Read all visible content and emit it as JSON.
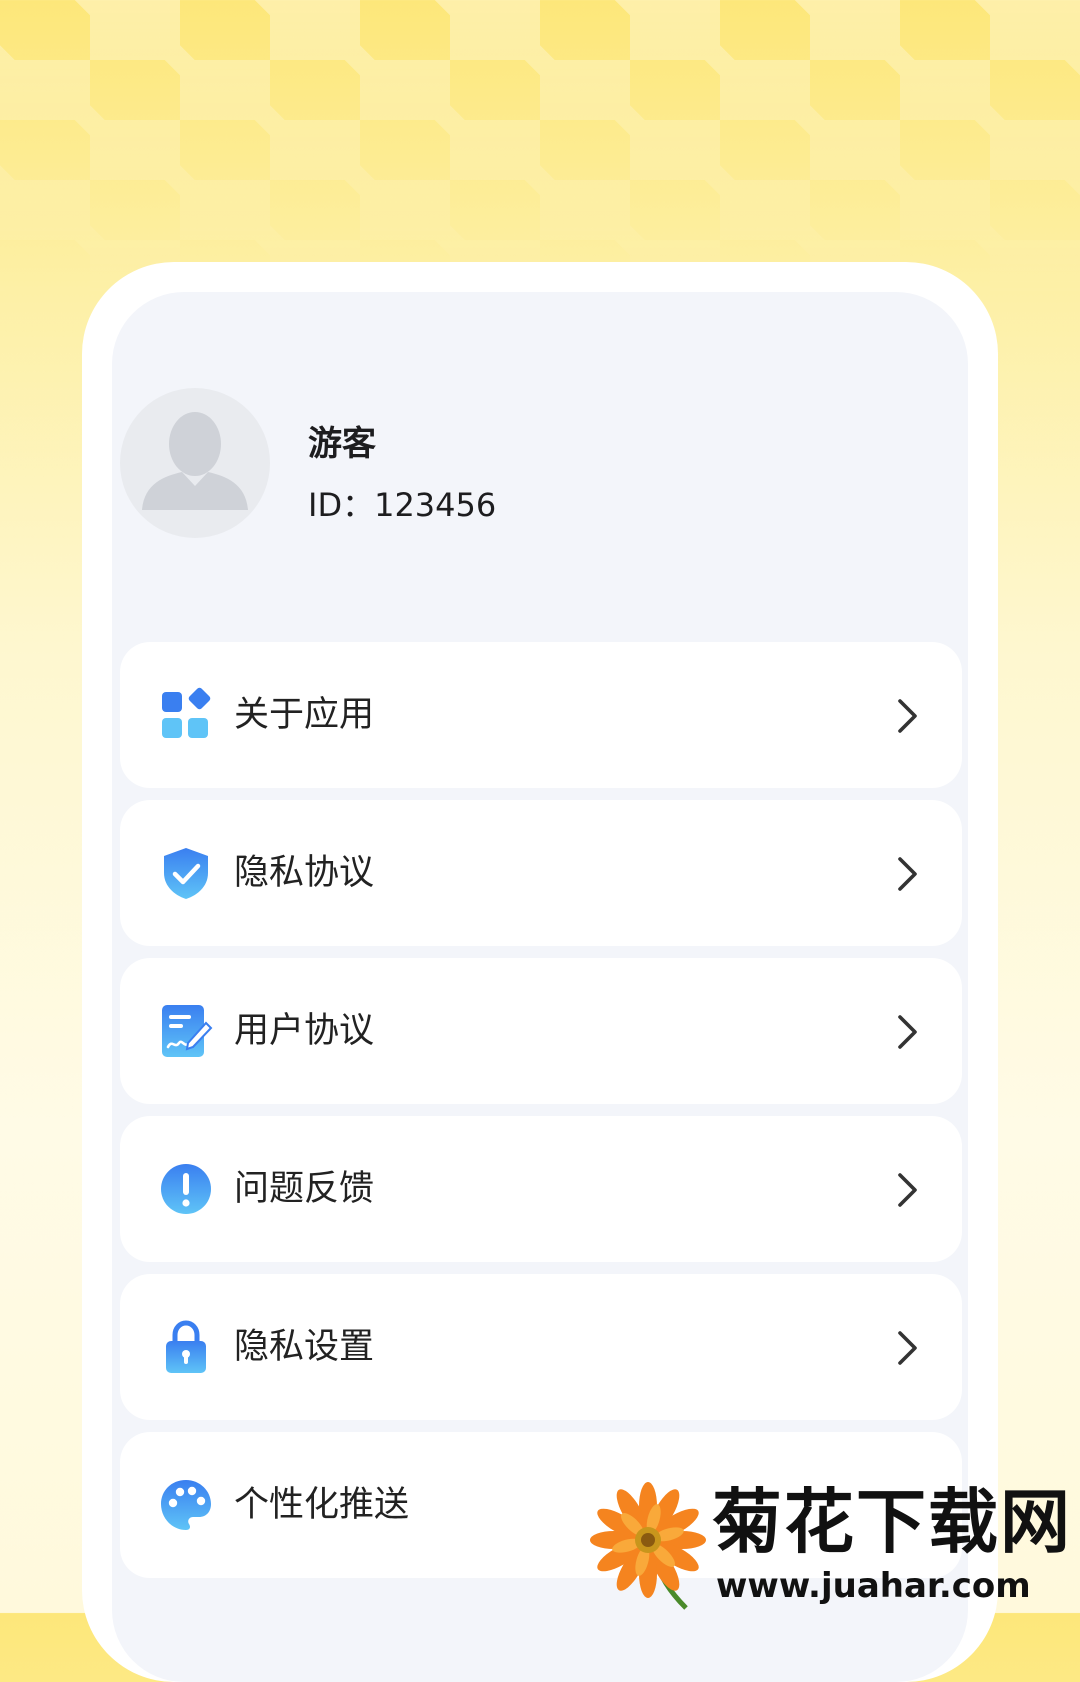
{
  "profile": {
    "name": "游客",
    "id_text": "ID：123456"
  },
  "menu": {
    "items": [
      {
        "label": "关于应用",
        "icon": "app-grid-icon"
      },
      {
        "label": "隐私协议",
        "icon": "shield-check-icon"
      },
      {
        "label": "用户协议",
        "icon": "document-sign-icon"
      },
      {
        "label": "问题反馈",
        "icon": "exclamation-icon"
      },
      {
        "label": "隐私设置",
        "icon": "lock-icon"
      },
      {
        "label": "个性化推送",
        "icon": "palette-icon"
      }
    ]
  },
  "watermark": {
    "title": "菊花下载网",
    "url": "www.juahar.com"
  },
  "colors": {
    "accent_blue": "#3a8df2",
    "icon_light_blue": "#5fc4f7",
    "card_bg": "#ffffff",
    "screen_bg": "#f3f5fa",
    "background_yellow": "#fde77a"
  }
}
